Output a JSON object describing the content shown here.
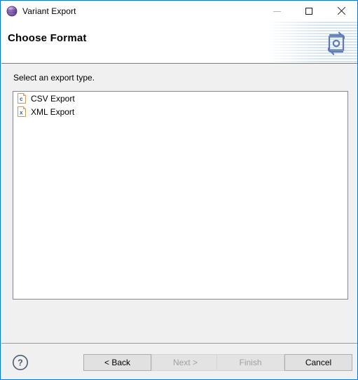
{
  "window": {
    "title": "Variant Export",
    "title_icon": "purple-sphere-icon",
    "border_color": "#0078d7",
    "controls": {
      "minimize": "minimize-icon",
      "maximize": "maximize-icon",
      "close": "close-icon"
    }
  },
  "header": {
    "title": "Choose Format",
    "banner_icon": "export-refresh-icon",
    "banner_icon_color": "#5b7cb5"
  },
  "main": {
    "prompt": "Select an export type.",
    "list_items": [
      {
        "label": "CSV Export",
        "icon": "csv-file-icon",
        "glyph": "c"
      },
      {
        "label": "XML Export",
        "icon": "xml-file-icon",
        "glyph": "x"
      }
    ]
  },
  "footer": {
    "help_label": "?",
    "help_icon": "help-circle-icon",
    "buttons": [
      {
        "label": "< Back",
        "enabled": true
      },
      {
        "label": "Next >",
        "enabled": false
      },
      {
        "label": "Finish",
        "enabled": false
      },
      {
        "label": "Cancel",
        "enabled": true
      }
    ]
  }
}
